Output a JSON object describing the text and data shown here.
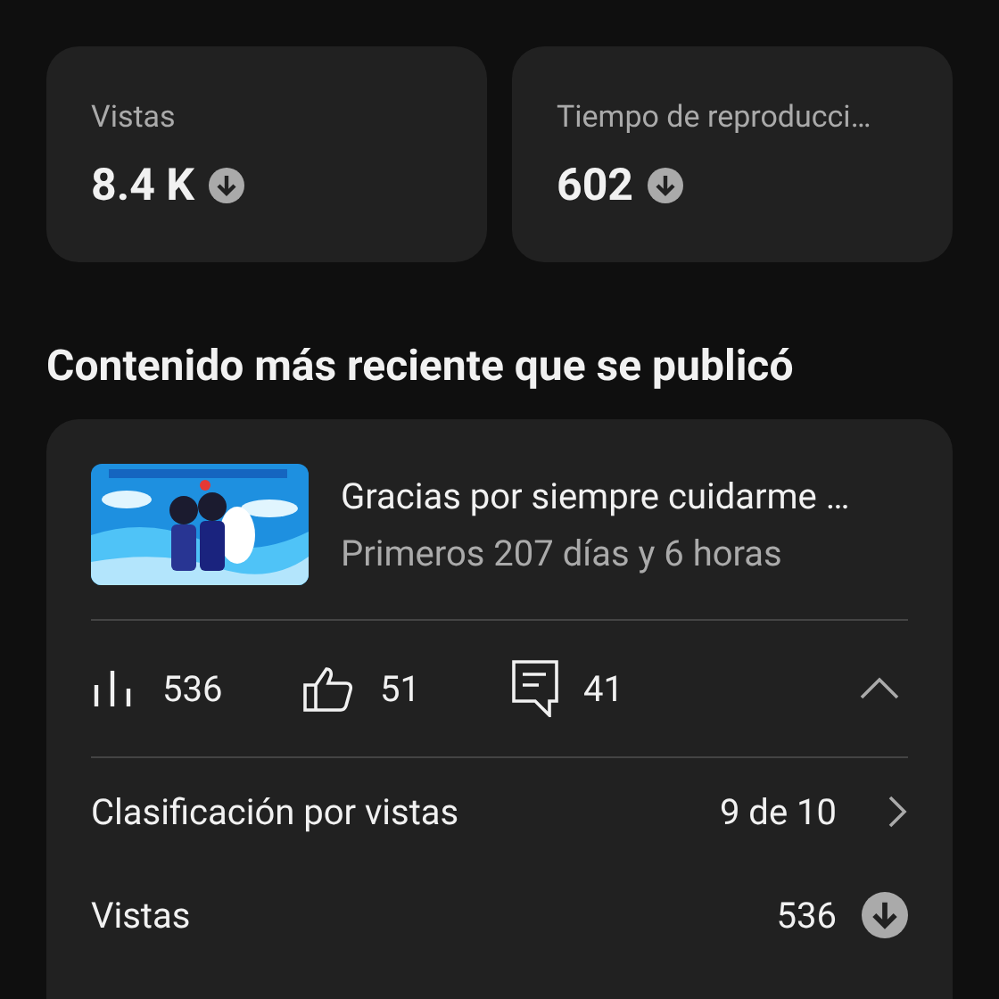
{
  "stats": [
    {
      "label": "Vistas",
      "value": "8.4 K",
      "decreasing": true
    },
    {
      "label": "Tiempo de reproducci…",
      "value": "602",
      "decreasing": true
    }
  ],
  "latest": {
    "heading": "Contenido más reciente que se publicó",
    "video": {
      "title": "Gracias por siempre cuidarme …",
      "subtitle": "Primeros 207 días y 6 horas"
    },
    "metrics": [
      {
        "kind": "views",
        "value": "536"
      },
      {
        "kind": "likes",
        "value": "51"
      },
      {
        "kind": "comments",
        "value": "41"
      }
    ],
    "expanded": true,
    "rows": [
      {
        "label": "Clasificación por vistas",
        "value": "9 de 10",
        "kind": "link"
      },
      {
        "label": "Vistas",
        "value": "536",
        "kind": "trend",
        "decreasing": true
      }
    ]
  }
}
